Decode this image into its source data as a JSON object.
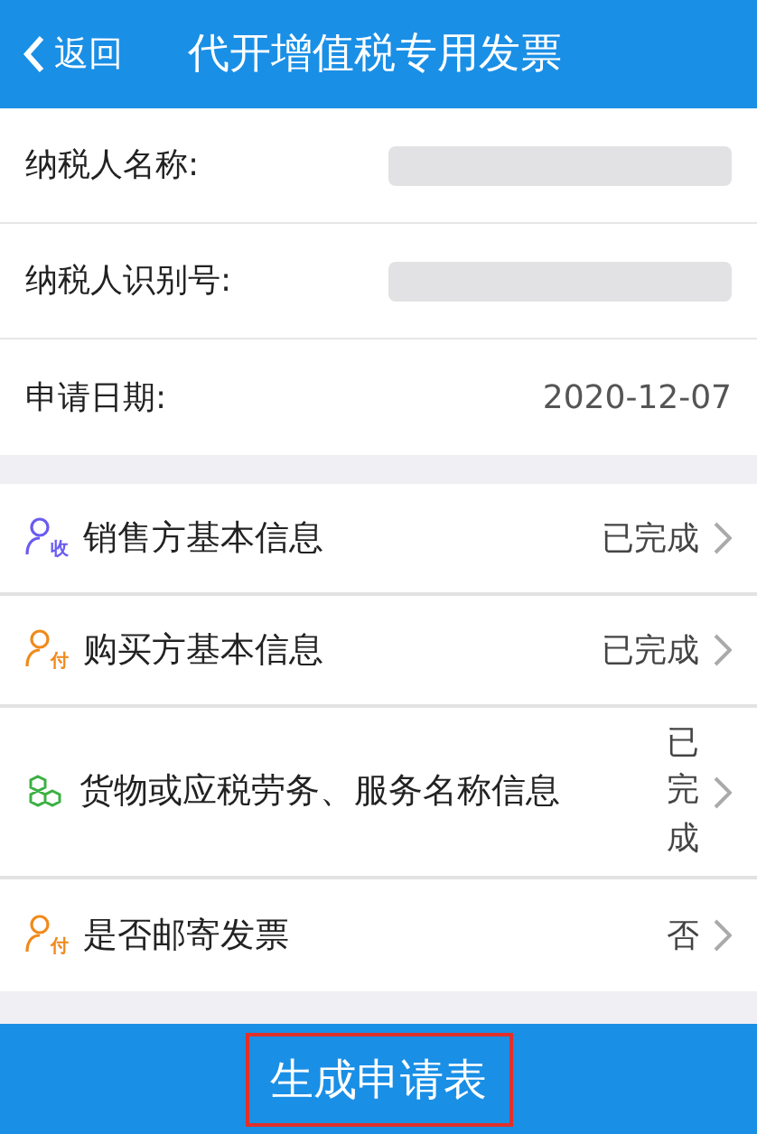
{
  "header": {
    "back": "返回",
    "title": "代开增值税专用发票"
  },
  "fields": [
    {
      "label": "纳税人名称:",
      "redacted": true
    },
    {
      "label": "纳税人识别号:",
      "redacted": true
    },
    {
      "label": "申请日期:",
      "value": "2020-12-07"
    }
  ],
  "sections": [
    {
      "kind": "person",
      "badge": "收",
      "color": "#6a5cf0",
      "label": "销售方基本信息",
      "status": "已完成",
      "stacked": false
    },
    {
      "kind": "person",
      "badge": "付",
      "color": "#f08a1c",
      "label": "购买方基本信息",
      "status": "已完成",
      "stacked": false
    },
    {
      "kind": "cubes",
      "color": "#3cb043",
      "label": "货物或应税劳务、服务名称信息",
      "status": "已完成",
      "stacked": true
    },
    {
      "kind": "person",
      "badge": "付",
      "color": "#f08a1c",
      "label": "是否邮寄发票",
      "status": "否",
      "stacked": false
    }
  ],
  "submit": "生成申请表"
}
